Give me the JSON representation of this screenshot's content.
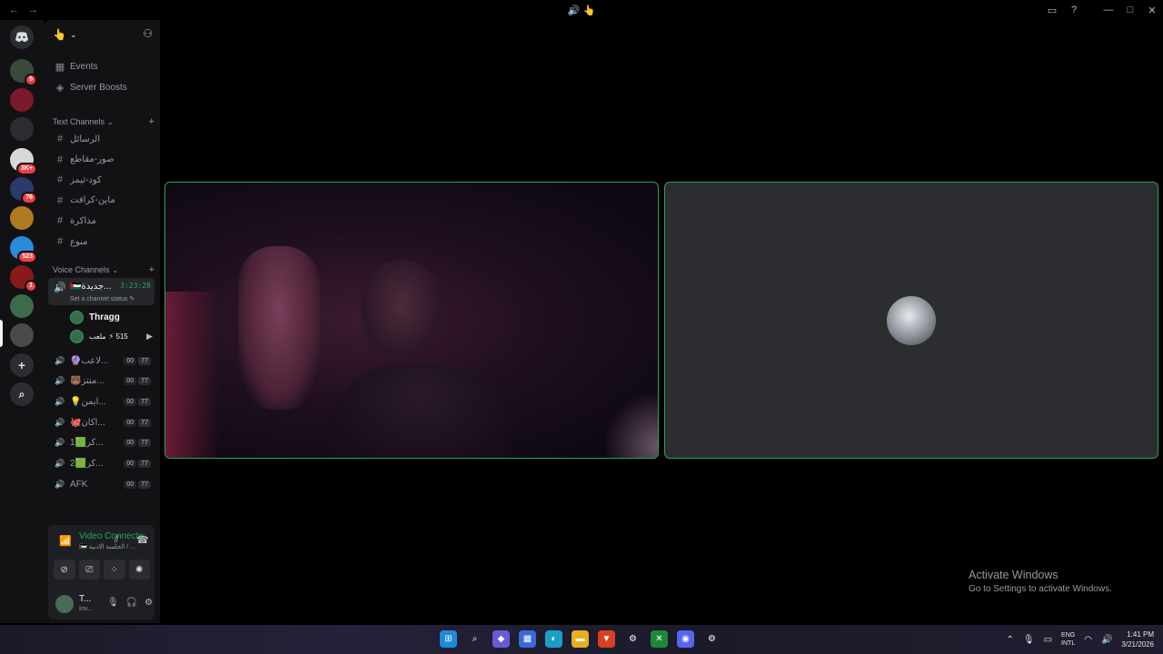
{
  "titlebar": {
    "back_icon": "←",
    "forward_icon": "→",
    "center_icons": "🔊 👆",
    "inbox_icon": "▭",
    "help_icon": "?",
    "minimize": "—",
    "maximize": "□",
    "close": "✕"
  },
  "rail": {
    "servers": [
      {
        "name": "server-1",
        "color": "#3a4a3a",
        "badge": "5"
      },
      {
        "name": "server-2",
        "color": "#7a1a2a",
        "badge": ""
      },
      {
        "name": "server-folder",
        "color": "#2b2d31",
        "badge": ""
      },
      {
        "name": "server-3",
        "color": "#d8d8d8",
        "badge": "3K+"
      },
      {
        "name": "server-4",
        "color": "#2a3a6a",
        "badge": "76"
      },
      {
        "name": "server-5",
        "color": "#b07a20",
        "badge": ""
      },
      {
        "name": "server-6",
        "color": "#2a8ad8",
        "badge": "523"
      },
      {
        "name": "server-7",
        "color": "#8a1a1a",
        "badge": "1"
      },
      {
        "name": "server-8",
        "color": "#3a6b4a",
        "badge": ""
      },
      {
        "name": "server-9",
        "color": "#4a4a4a",
        "badge": ""
      }
    ],
    "add_icon": "+",
    "discover_icon": "⌕"
  },
  "sidebar": {
    "server_name": "👆",
    "events": "Events",
    "server_boosts": "Server Boosts",
    "text_category": "Text Channels",
    "text_channels": [
      "الرسائل",
      "صور-مقاطع",
      "كود-ثيمز",
      "ماين-كرافت",
      "مذاكرة",
      "منوع"
    ],
    "voice_category": "Voice Channels",
    "active_voice": {
      "label": "🇵🇸جديدة...",
      "timer": "3:23:28",
      "status": "Set a channel status"
    },
    "members": [
      {
        "name": "Thragg",
        "extra": ""
      },
      {
        "name": "ملعب",
        "extra": "⚡ 515"
      }
    ],
    "voice_channels": [
      {
        "label": "🔮لاعب...",
        "a": "00",
        "b": "77"
      },
      {
        "label": "🐻منتز...",
        "a": "00",
        "b": "77"
      },
      {
        "label": "💡ايمن...",
        "a": "00",
        "b": "77"
      },
      {
        "label": "🐙اكان...",
        "a": "00",
        "b": "77"
      },
      {
        "label": "1🟩كر...",
        "a": "00",
        "b": "77"
      },
      {
        "label": "2🟩كر...",
        "a": "00",
        "b": "77"
      },
      {
        "label": "AFK",
        "a": "00",
        "b": "77"
      }
    ]
  },
  "voice_panel": {
    "title": "Video Connected",
    "subtitle": "🇵🇸 الجلسة الادبية / ...",
    "user_name": "T...",
    "user_status": "Inv..."
  },
  "watermark": {
    "line1": "Activate Windows",
    "line2": "Go to Settings to activate Windows."
  },
  "taskbar": {
    "lang_top": "ENG",
    "lang_bottom": "INTL",
    "time": "1:41 PM",
    "date": "3/21/2026",
    "apps": [
      {
        "name": "start-icon",
        "glyph": "⊞",
        "color": "#1e8ad8"
      },
      {
        "name": "search-icon",
        "glyph": "⌕",
        "color": "transparent"
      },
      {
        "name": "copilot-icon",
        "glyph": "◆",
        "color": "#6a5ad8"
      },
      {
        "name": "store-icon",
        "glyph": "▦",
        "color": "#3a6ad8"
      },
      {
        "name": "edge-icon",
        "glyph": "◐",
        "color": "#1aa0c8"
      },
      {
        "name": "folder-icon",
        "glyph": "▬",
        "color": "#e8b020"
      },
      {
        "name": "brave-icon",
        "glyph": "▼",
        "color": "#d84020"
      },
      {
        "name": "steam-icon",
        "glyph": "⚙",
        "color": "transparent"
      },
      {
        "name": "xbox-icon",
        "glyph": "✕",
        "color": "#1a8a3a"
      },
      {
        "name": "discord-icon",
        "glyph": "◉",
        "color": "#5865f2"
      },
      {
        "name": "steam2-icon",
        "glyph": "⚙",
        "color": "transparent"
      }
    ]
  }
}
